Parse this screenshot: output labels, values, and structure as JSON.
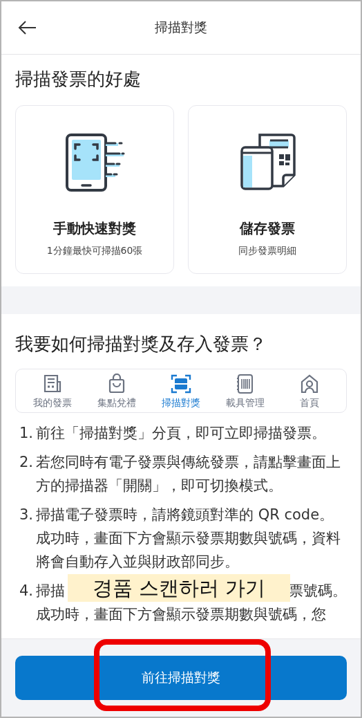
{
  "header": {
    "title": "掃描對獎"
  },
  "benefits": {
    "title": "掃描發票的好處",
    "cards": [
      {
        "kind": "phone",
        "title": "手動快速對獎",
        "subtitle": "1分鐘最快可掃描60張"
      },
      {
        "kind": "receipt",
        "title": "儲存發票",
        "subtitle": "同步發票明細"
      }
    ]
  },
  "howto": {
    "title": "我要如何掃描對獎及存入發票？",
    "tabs": [
      {
        "kind": "invoice",
        "label": "我的發票",
        "selected": false
      },
      {
        "kind": "bag",
        "label": "集點兌禮",
        "selected": false
      },
      {
        "kind": "scan",
        "label": "掃描對獎",
        "selected": true
      },
      {
        "kind": "barcode",
        "label": "載具管理",
        "selected": false
      },
      {
        "kind": "home",
        "label": "首頁",
        "selected": false
      }
    ],
    "steps": [
      {
        "kind": "full",
        "number": "1.",
        "text": "前往「掃描對獎」分頁，即可立即掃描發票。"
      },
      {
        "kind": "full",
        "number": "2.",
        "text": "若您同時有電子發票與傳統發票，請點擊畫面上方的掃描器「開關」，即可切換模式。"
      },
      {
        "kind": "full",
        "number": "3.",
        "text": "掃描電子發票時，請將鏡頭對準的 QR code。成功時，畫面下方會顯示發票期數與號碼，資料將會自動存入並與財政部同步。"
      },
      {
        "kind": "partial",
        "number": "4.",
        "start": "掃描",
        "end": "票號碼。",
        "continuation": "成功時，畫面下方會顯示發票期數與號碼，您"
      }
    ]
  },
  "button": {
    "label": "前往掃描對獎"
  },
  "annotation": {
    "label": "경품 스캔하러 가기"
  }
}
